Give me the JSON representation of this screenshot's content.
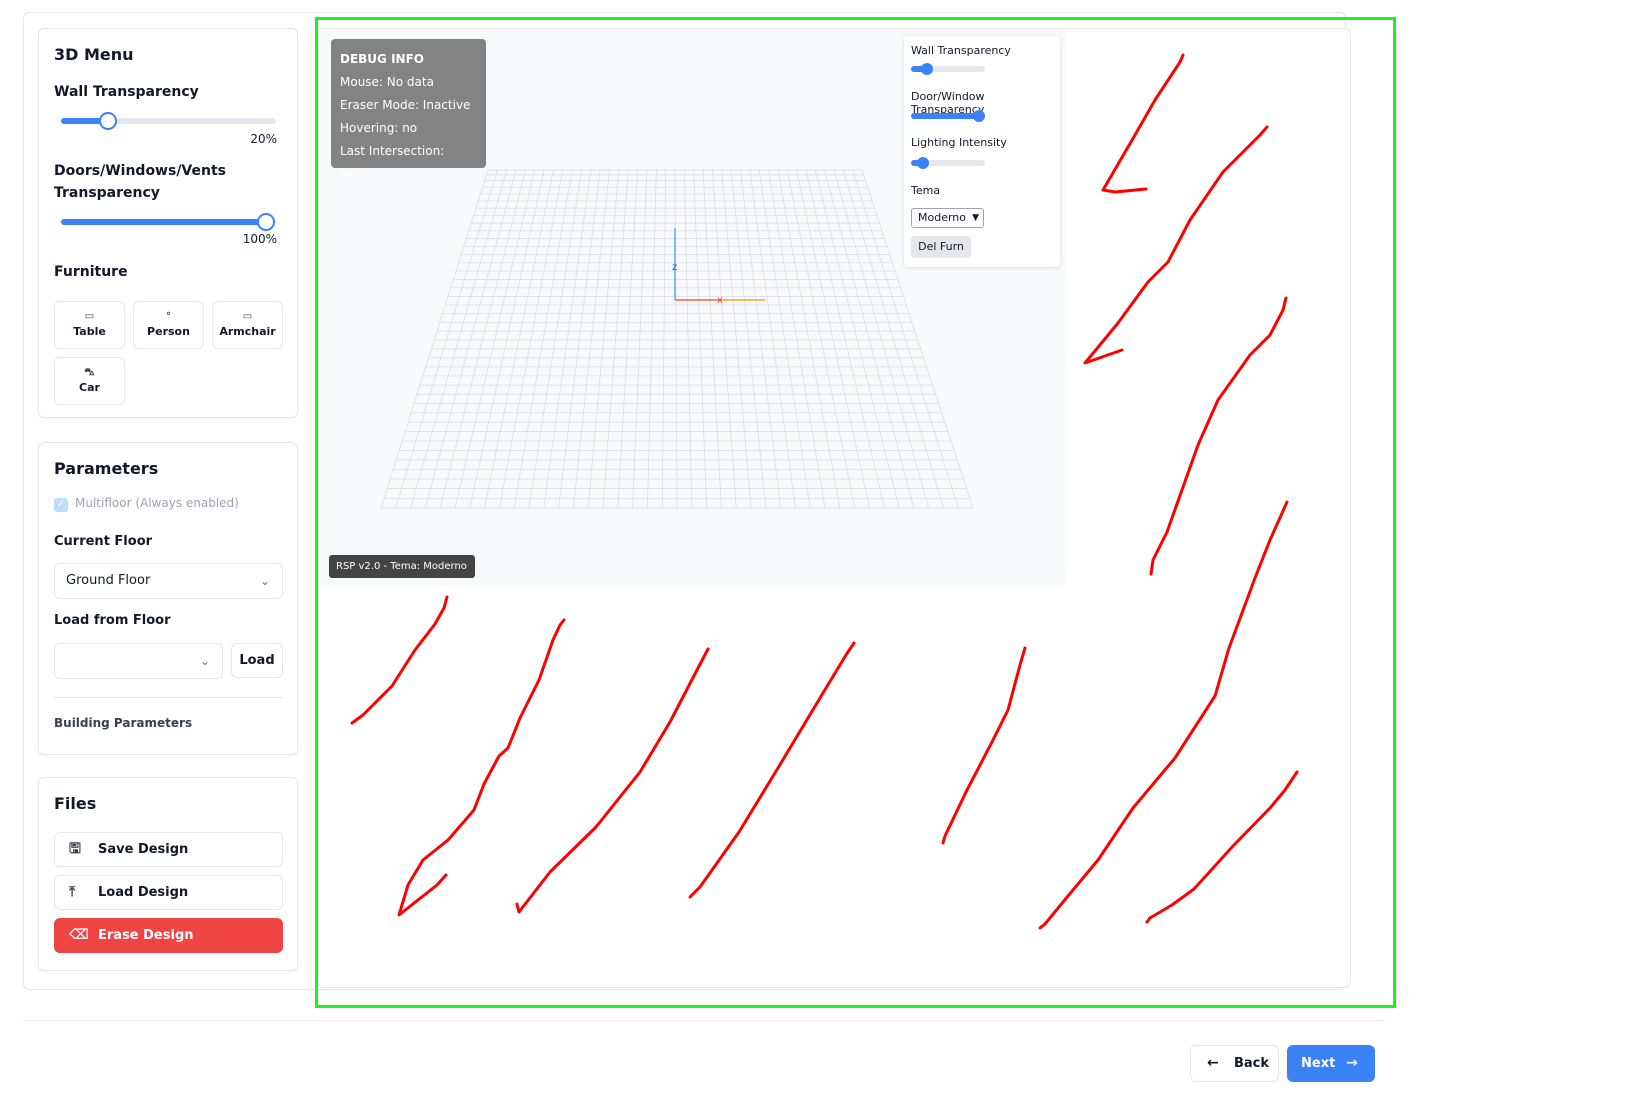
{
  "menu3d": {
    "title": "3D Menu",
    "wall_transparency_label": "Wall Transparency",
    "wall_transparency_value": "20%",
    "wall_transparency_fraction": 0.2,
    "doors_transparency_label": "Doors/Windows/Vents Transparency",
    "doors_transparency_value": "100%",
    "doors_transparency_fraction": 1.0,
    "furniture_label": "Furniture",
    "furniture": [
      {
        "label": "Table",
        "icon": "rectangle-icon"
      },
      {
        "label": "Person",
        "icon": "circle-icon"
      },
      {
        "label": "Armchair",
        "icon": "rectangle-icon"
      },
      {
        "label": "Car",
        "icon": "car-icon"
      }
    ]
  },
  "parameters": {
    "title": "Parameters",
    "multifloor_label": "Multifloor (Always enabled)",
    "current_floor_label": "Current Floor",
    "current_floor_value": "Ground Floor",
    "load_from_floor_label": "Load from Floor",
    "load_from_floor_value": "",
    "load_button": "Load",
    "building_parameters_label": "Building Parameters"
  },
  "files": {
    "title": "Files",
    "save_label": "Save Design",
    "load_label": "Load Design",
    "erase_label": "Erase Design"
  },
  "debug": {
    "title": "DEBUG INFO",
    "mouse": "Mouse: No data",
    "eraser": "Eraser Mode: Inactive",
    "hovering": "Hovering: no",
    "intersection": "Last Intersection: None"
  },
  "viewer_controls": {
    "wall_label": "Wall Transparency",
    "wall_fraction": 0.2,
    "door_label": "Door/Window Transparency",
    "door_fraction": 1.0,
    "lighting_label": "Lighting Intensity",
    "lighting_fraction": 0.15,
    "tema_label": "Tema",
    "tema_value": "Moderno",
    "delete_furniture_label": "Del Furn"
  },
  "axes": {
    "z_label": "z",
    "x_label": "x"
  },
  "version_badge": "RSP v2.0 - Tema: Moderno",
  "navigation": {
    "back_label": "Back",
    "next_label": "Next"
  },
  "colors": {
    "accent": "#3b82f6",
    "danger": "#ef4444",
    "annotation_frame": "#1cf31c",
    "annotation_stroke": "#ff0000"
  }
}
